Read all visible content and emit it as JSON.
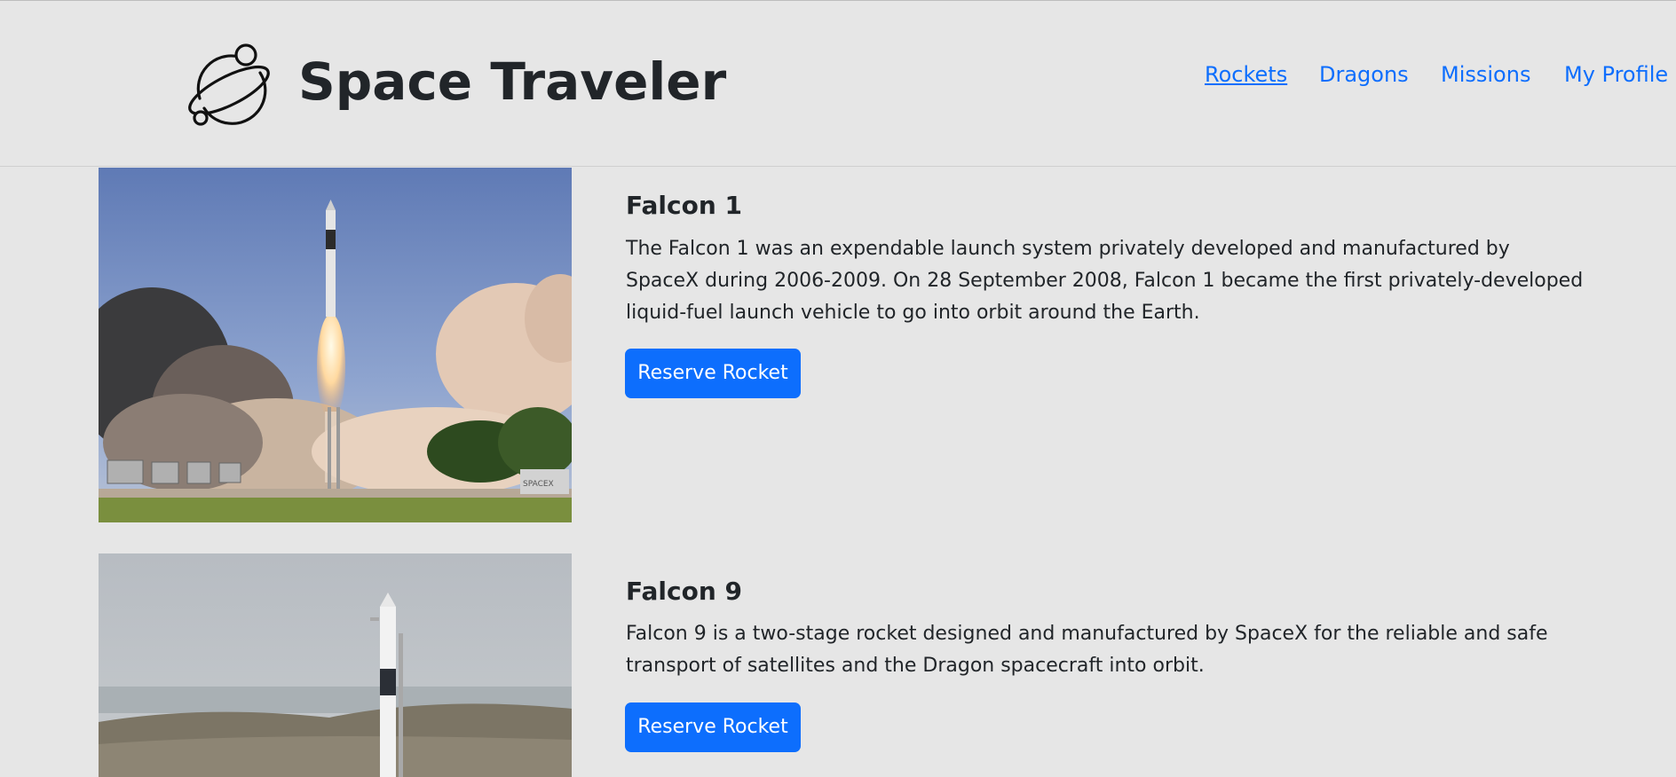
{
  "header": {
    "brand_title": "Space Traveler",
    "logo_icon": "planet-icon"
  },
  "nav": {
    "items": [
      {
        "label": "Rockets",
        "active": true
      },
      {
        "label": "Dragons",
        "active": false
      },
      {
        "label": "Missions",
        "active": false
      },
      {
        "label": "My Profile",
        "active": false
      }
    ]
  },
  "rockets": [
    {
      "name": "Falcon 1",
      "description": "The Falcon 1 was an expendable launch system privately developed and manufactured by SpaceX during 2006-2009. On 28 September 2008, Falcon 1 became the first privately-developed liquid-fuel launch vehicle to go into orbit around the Earth.",
      "button_label": "Reserve Rocket",
      "image_label": "SPACEX"
    },
    {
      "name": "Falcon 9",
      "description": "Falcon 9 is a two-stage rocket designed and manufactured by SpaceX for the reliable and safe transport of satellites and the Dragon spacecraft into orbit.",
      "button_label": "Reserve Rocket"
    }
  ],
  "colors": {
    "background": "#e6e6e6",
    "link": "#0d6efd",
    "button": "#0d6efd",
    "text": "#212529"
  }
}
